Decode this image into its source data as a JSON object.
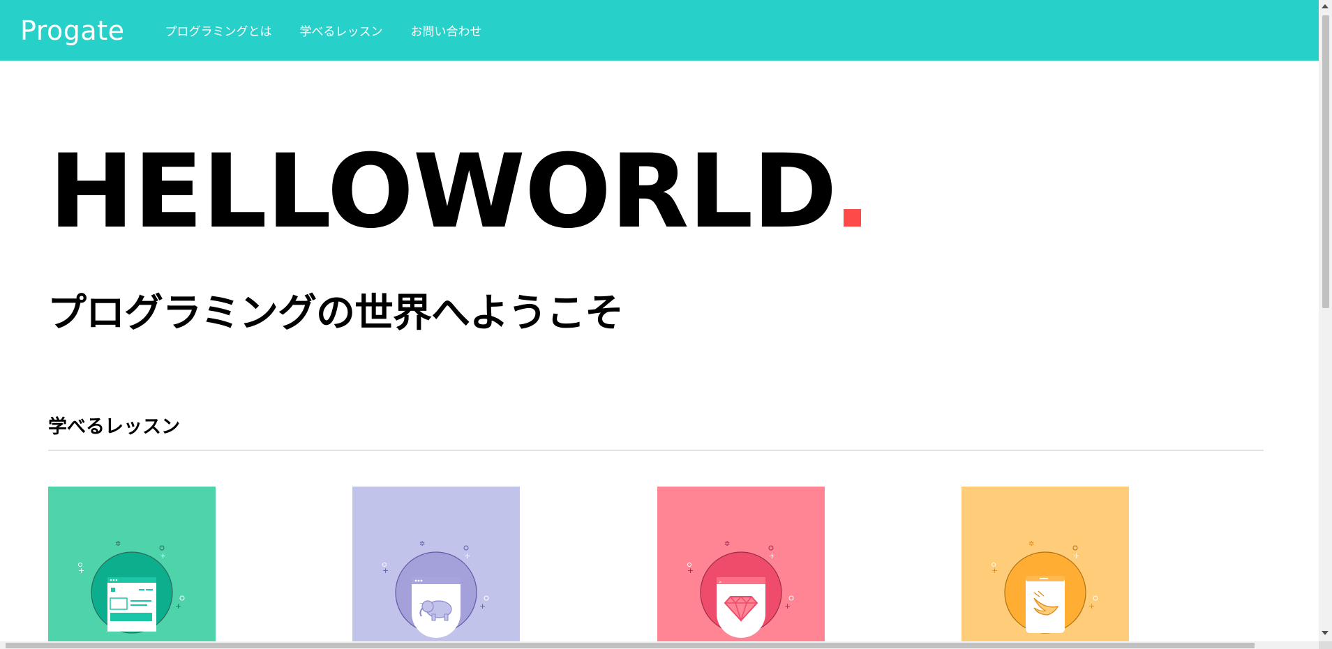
{
  "header": {
    "logo": "Progate",
    "nav": [
      "プログラミングとは",
      "学べるレッスン",
      "お問い合わせ"
    ],
    "background_color": "#28d0ca"
  },
  "hero": {
    "title": "HELLOWORLD",
    "dot_color": "#ff4a4a",
    "subtitle": "プログラミングの世界へようこそ"
  },
  "lessons_section": {
    "heading": "学べるレッスン",
    "cards": [
      {
        "topic": "html-css",
        "icon": "browser-layout-icon",
        "bg_color": "#4fd3aa",
        "circle_color": "#0dae8e",
        "accent_color": "#1ac6a6"
      },
      {
        "topic": "php",
        "icon": "elephant-icon",
        "bg_color": "#c2c3ea",
        "circle_color": "#a4a1da",
        "accent_color": "#a7a5de"
      },
      {
        "topic": "ruby",
        "icon": "gem-icon",
        "bg_color": "#ff8595",
        "circle_color": "#ef4c6b",
        "accent_color": "#ff6f85"
      },
      {
        "topic": "swift",
        "icon": "swift-bird-icon",
        "bg_color": "#ffcc7a",
        "circle_color": "#ffad33",
        "accent_color": "#ffb951"
      }
    ]
  }
}
